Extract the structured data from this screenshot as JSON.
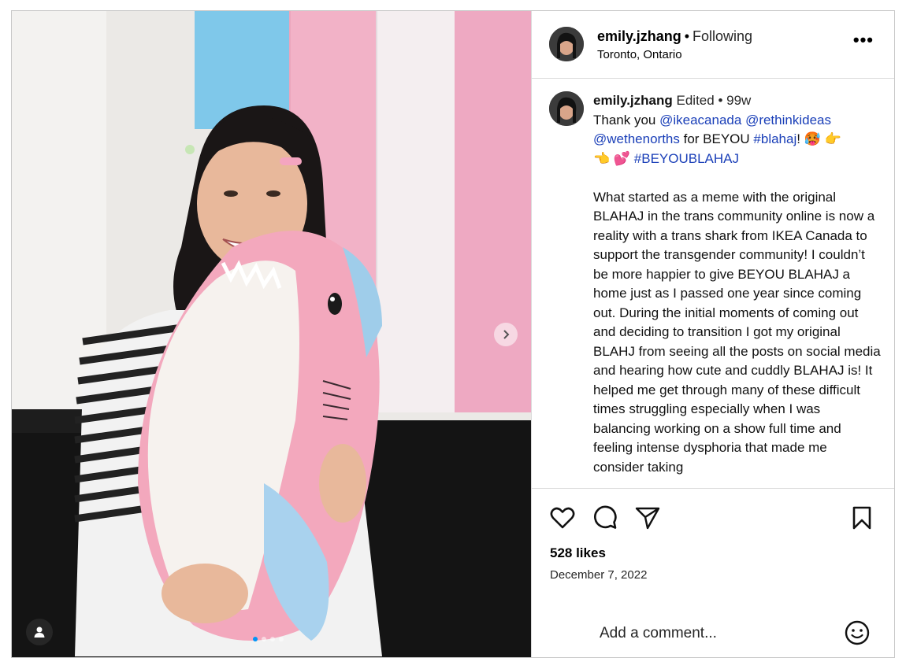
{
  "post": {
    "username": "emily.jzhang",
    "follow_separator": "•",
    "follow_status": "Following",
    "location": "Toronto, Ontario",
    "more_label": "•••"
  },
  "caption": {
    "username": "emily.jzhang",
    "edited": "Edited",
    "meta_separator": "•",
    "age": "99w",
    "line1_prefix": "Thank you ",
    "mention1": "@ikeacanada",
    "mention2": "@rethinkideas",
    "mention3": "@wethenorths",
    "mid_text": " for BEYOU ",
    "hashtag1": "#blahaj",
    "emoji_after_hashtag": "! 🥵 👉",
    "emoji_line3": "👈 💕 ",
    "hashtag2": "#BEYOUBLAHAJ",
    "body": "What started as a meme with the original BLAHAJ in the trans community online is now a reality with a trans shark from IKEA Canada to support the transgender community! I couldn’t be more happier to give BEYOU BLAHAJ a home just as I passed one year since coming out. During the initial moments of coming out and deciding to transition I got my original BLAHJ from seeing all the posts on social media and hearing how cute and cuddly BLAHAJ is! It helped me get through many of these difficult times struggling especially when I was balancing working on a show full time and feeling intense dysphoria that made me consider taking"
  },
  "stats": {
    "likes": "528 likes",
    "date": "December 7, 2022"
  },
  "comment": {
    "placeholder": "Add a comment..."
  },
  "carousel": {
    "total_slides": 4,
    "active_slide": 1
  },
  "icons": {
    "like": "heart-icon",
    "comment": "comment-icon",
    "share": "send-icon",
    "save": "bookmark-icon",
    "emoji": "smiley-icon",
    "next": "chevron-right-icon",
    "tags": "user-tag-icon"
  },
  "colors": {
    "trans_blue": "#7fc8ea",
    "trans_pink": "#f2b2c7",
    "link": "#1a3fb8",
    "active_dot": "#0095f6"
  }
}
